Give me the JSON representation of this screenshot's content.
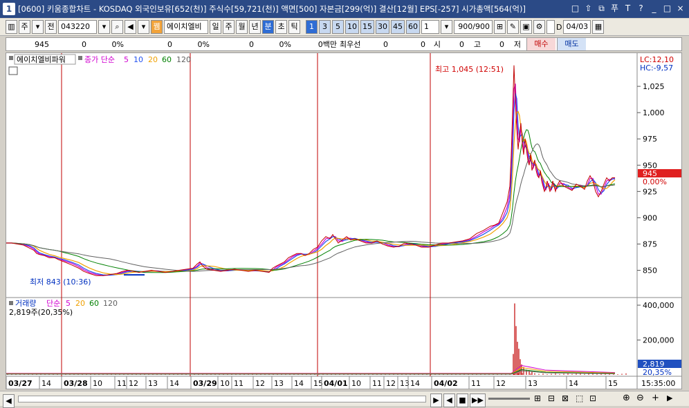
{
  "window": {
    "app_icon": "1",
    "title": "[0600] 키움종합차트 - KOSDAQ 외국인보유[652(천)] 주식수[59,721(천)] 액면[500] 자본금[299(억)] 결산[12월] EPS[-257] 시가총액[564(억)]",
    "controls": [
      "□",
      "⇧",
      "⧉",
      "푸",
      "T",
      "?",
      "_",
      "□",
      "×"
    ]
  },
  "toolbar": {
    "market_btn": "주",
    "prev_btn": "전",
    "code": "043220",
    "stock_name": "에이치엘비",
    "period_buttons": [
      "일",
      "주",
      "월",
      "년",
      "분",
      "초",
      "틱"
    ],
    "active_period": "분",
    "minute_buttons": [
      "1",
      "3",
      "5",
      "10",
      "15",
      "30",
      "45",
      "60"
    ],
    "active_minute": "1",
    "unit_value": "1",
    "count": "900/900",
    "date_label": "D",
    "date": "04/03"
  },
  "infobar": {
    "price": "945",
    "change": "0",
    "change_pct": "0%",
    "vol1": "0",
    "vol1_pct": "0%",
    "vol2": "0",
    "vol2_pct": "0%",
    "amount": "0백만",
    "best_label": "최우선",
    "best_sell": "0",
    "best_buy": "0",
    "open_label": "시",
    "open_val": "0",
    "high_label": "고",
    "high_val": "0",
    "low_label": "저",
    "low_val": "0",
    "buy_btn": "매수",
    "sell_btn": "매도"
  },
  "chart_data": {
    "type": "line",
    "price_panel": {
      "stock_label": "에이치엘비파워",
      "ma_label": "종가 단순",
      "ma_periods": [
        "5",
        "10",
        "20",
        "60",
        "120"
      ],
      "ma_colors": [
        "#d000d0",
        "#2050f0",
        "#f0a000",
        "#008000",
        "#606060"
      ],
      "lc_text": "LC:12,10",
      "hc_text": "HC:-9,57",
      "high_annotation": "최고 1,045 (12:51)",
      "low_annotation": "최저 843 (10:36)",
      "current_price": "945",
      "current_pct": "0.00%",
      "y_ticks": [
        "1,025",
        "1,000",
        "975",
        "950",
        "925",
        "900",
        "875",
        "850"
      ],
      "y_tick_values": [
        1025,
        1000,
        975,
        950,
        925,
        900,
        875,
        850
      ],
      "ylim": [
        830,
        1050
      ],
      "price_path_x": [
        0,
        8,
        16,
        25,
        34,
        40,
        44,
        48,
        55,
        62,
        70,
        76,
        84,
        95,
        105,
        112,
        120,
        130,
        140,
        150,
        160,
        168,
        176,
        184,
        192,
        200,
        210,
        220,
        230,
        240,
        250,
        260,
        270,
        276,
        280,
        284,
        290,
        300,
        310,
        320,
        330,
        340,
        350,
        360,
        370,
        380,
        385,
        390,
        396,
        402,
        408,
        414,
        420,
        426,
        432,
        438,
        444,
        450,
        456,
        462,
        468,
        472,
        476,
        480,
        486,
        492,
        498,
        504,
        512,
        520,
        528,
        536,
        544,
        552,
        560,
        568,
        576,
        584,
        592,
        600,
        610,
        620,
        630,
        640,
        650,
        660,
        670,
        680,
        690,
        700,
        706,
        712,
        718,
        724,
        728,
        730,
        732,
        734,
        736,
        738,
        740,
        742,
        744,
        746,
        748,
        750,
        752,
        754,
        756,
        758,
        760,
        762,
        764,
        766,
        768,
        770,
        772,
        774,
        776,
        778,
        780,
        782,
        784,
        786,
        788,
        790,
        792,
        794,
        796,
        800,
        806,
        812,
        818,
        824,
        830,
        836,
        840,
        844,
        848,
        852,
        856,
        860,
        864,
        868,
        872,
        876,
        880
      ],
      "price_path_y": [
        876,
        876,
        875,
        874,
        871,
        869,
        866,
        865,
        864,
        862,
        862,
        860,
        858,
        855,
        852,
        849,
        847,
        845,
        845,
        846,
        847,
        849,
        850,
        849,
        848,
        849,
        850,
        849,
        848,
        849,
        850,
        851,
        852,
        856,
        858,
        854,
        851,
        850,
        849,
        850,
        851,
        850,
        849,
        850,
        849,
        848,
        852,
        854,
        856,
        858,
        862,
        864,
        866,
        866,
        864,
        866,
        870,
        872,
        878,
        882,
        880,
        884,
        880,
        876,
        879,
        882,
        879,
        880,
        878,
        876,
        876,
        878,
        875,
        873,
        872,
        873,
        876,
        875,
        874,
        872,
        872,
        874,
        876,
        876,
        877,
        878,
        880,
        885,
        888,
        892,
        893,
        895,
        905,
        915,
        930,
        960,
        1000,
        1045,
        1010,
        985,
        965,
        980,
        990,
        970,
        960,
        975,
        965,
        955,
        950,
        960,
        945,
        950,
        955,
        945,
        940,
        938,
        945,
        935,
        930,
        925,
        928,
        935,
        930,
        925,
        928,
        935,
        930,
        925,
        930,
        935,
        930,
        928,
        926,
        932,
        930,
        927,
        935,
        940,
        935,
        925,
        920,
        925,
        932,
        938,
        935,
        938,
        938,
        945
      ]
    },
    "volume_panel": {
      "label": "거래량",
      "ma_label": "단순",
      "ma_periods": [
        "5",
        "20",
        "60",
        "120"
      ],
      "ma_colors": [
        "#d000d0",
        "#f0a000",
        "#008000",
        "#606060"
      ],
      "current_text": "2,819주(20,35%)",
      "current_value": "2,819",
      "current_pct": "20,35%",
      "y_ticks": [
        "400,000",
        "200,000"
      ],
      "y_tick_values": [
        400000,
        200000
      ],
      "ylim": [
        0,
        420000
      ],
      "spike_x": [
        733,
        735,
        737,
        739,
        741,
        743,
        745,
        748,
        752,
        756,
        760
      ],
      "spike_values": [
        120000,
        410000,
        280000,
        190000,
        150000,
        90000,
        60000,
        45000,
        30000,
        25000,
        20000
      ]
    },
    "x_axis": {
      "labels": [
        "03/27",
        "14",
        "03/28",
        "10",
        "11",
        "12",
        "13",
        "14",
        "03/29",
        "10",
        "11",
        "12",
        "13",
        "14",
        "15",
        "04/01",
        "10",
        "11",
        "12",
        "13",
        "14",
        "04/02",
        "11",
        "12",
        "13",
        "14",
        "15"
      ],
      "label_x": [
        0,
        48,
        80,
        122,
        157,
        174,
        202,
        233,
        267,
        306,
        326,
        357,
        384,
        413,
        441,
        456,
        496,
        526,
        546,
        566,
        581,
        615,
        669,
        705,
        751,
        810,
        867
      ],
      "bold_labels": [
        "03/27",
        "03/28",
        "03/29",
        "04/01",
        "04/02"
      ],
      "day_dividers_x": [
        80,
        266,
        450,
        613
      ],
      "time_label": "15:35:00"
    }
  },
  "statusbar": {
    "nav_buttons": [
      "◀",
      "▶",
      "◀",
      "■",
      "▶▶"
    ],
    "tool_icons": [
      "⊞",
      "⊟",
      "⊠",
      "⬚",
      "⊡",
      "⊕",
      "⊖",
      "+",
      "▶"
    ]
  }
}
